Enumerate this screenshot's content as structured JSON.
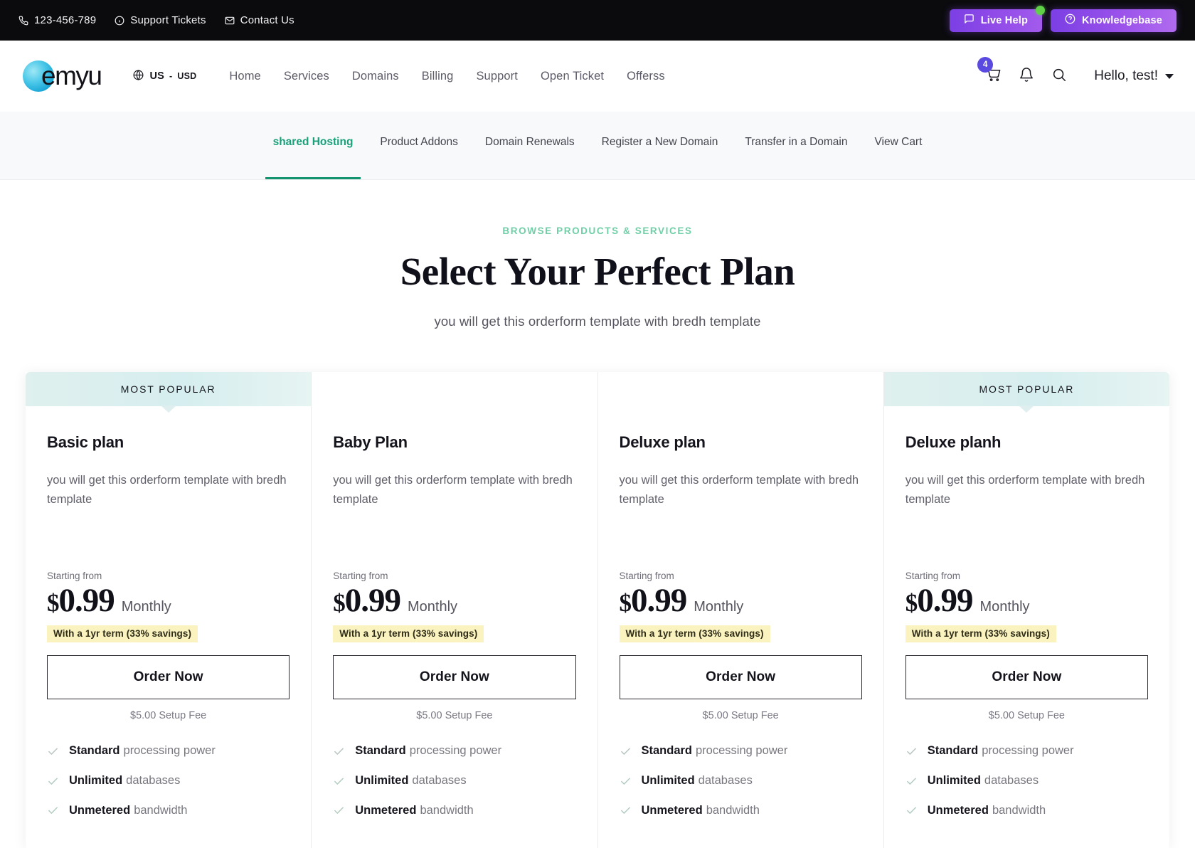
{
  "topbar": {
    "items": [
      {
        "icon": "phone-icon",
        "label": "123-456-789"
      },
      {
        "icon": "info-icon",
        "label": "Support Tickets"
      },
      {
        "icon": "envelope-icon",
        "label": "Contact Us"
      }
    ],
    "live_help": "Live Help",
    "knowledgebase": "Knowledgebase",
    "accent_purple": "#8f4ae8",
    "status_dot_color": "#5fd048"
  },
  "navbar": {
    "logo_text": "emyu",
    "currency_main": "US",
    "currency_sep": "-",
    "currency_code": "USD",
    "links": [
      "Home",
      "Services",
      "Domains",
      "Billing",
      "Support",
      "Open Ticket",
      "Offerss"
    ],
    "cart_count": "4",
    "greeting": "Hello, test!"
  },
  "subnav": {
    "tabs": [
      {
        "label": "shared Hosting",
        "active": true
      },
      {
        "label": "Product Addons",
        "active": false
      },
      {
        "label": "Domain Renewals",
        "active": false
      },
      {
        "label": "Register a New Domain",
        "active": false
      },
      {
        "label": "Transfer in a Domain",
        "active": false
      },
      {
        "label": "View Cart",
        "active": false
      }
    ],
    "active_color": "#13946e"
  },
  "hero": {
    "eyebrow": "BROWSE PRODUCTS & SERVICES",
    "title": "Select Your Perfect Plan",
    "subtitle": "you will get this orderform template with bredh template"
  },
  "pricing": {
    "popular_label": "MOST POPULAR",
    "starting_label": "Starting from",
    "cards": [
      {
        "popular": true,
        "banner": "MOST POPULAR",
        "name": "Basic plan",
        "desc": "you will get this orderform template with bredh template",
        "currency": "$",
        "price": "0.99",
        "cycle": "Monthly",
        "savings": "With a 1yr term (33% savings)",
        "order_label": "Order Now",
        "setup_fee": "$5.00 Setup Fee",
        "features": [
          {
            "strong": "Standard",
            "rest": "processing power"
          },
          {
            "strong": "Unlimited",
            "rest": "databases"
          },
          {
            "strong": "Unmetered",
            "rest": "bandwidth"
          }
        ]
      },
      {
        "popular": false,
        "banner": "",
        "name": "Baby Plan",
        "desc": "you will get this orderform template with bredh template",
        "currency": "$",
        "price": "0.99",
        "cycle": "Monthly",
        "savings": "With a 1yr term (33% savings)",
        "order_label": "Order Now",
        "setup_fee": "$5.00 Setup Fee",
        "features": [
          {
            "strong": "Standard",
            "rest": "processing power"
          },
          {
            "strong": "Unlimited",
            "rest": "databases"
          },
          {
            "strong": "Unmetered",
            "rest": "bandwidth"
          }
        ]
      },
      {
        "popular": false,
        "banner": "",
        "name": "Deluxe plan",
        "desc": "you will get this orderform template with bredh template",
        "currency": "$",
        "price": "0.99",
        "cycle": "Monthly",
        "savings": "With a 1yr term (33% savings)",
        "order_label": "Order Now",
        "setup_fee": "$5.00 Setup Fee",
        "features": [
          {
            "strong": "Standard",
            "rest": "processing power"
          },
          {
            "strong": "Unlimited",
            "rest": "databases"
          },
          {
            "strong": "Unmetered",
            "rest": "bandwidth"
          }
        ]
      },
      {
        "popular": true,
        "banner": "MOST POPULAR",
        "name": "Deluxe planh",
        "desc": "you will get this orderform template with bredh template",
        "currency": "$",
        "price": "0.99",
        "cycle": "Monthly",
        "savings": "With a 1yr term (33% savings)",
        "order_label": "Order Now",
        "setup_fee": "$5.00 Setup Fee",
        "features": [
          {
            "strong": "Standard",
            "rest": "processing power"
          },
          {
            "strong": "Unlimited",
            "rest": "databases"
          },
          {
            "strong": "Unmetered",
            "rest": "bandwidth"
          }
        ]
      }
    ]
  }
}
